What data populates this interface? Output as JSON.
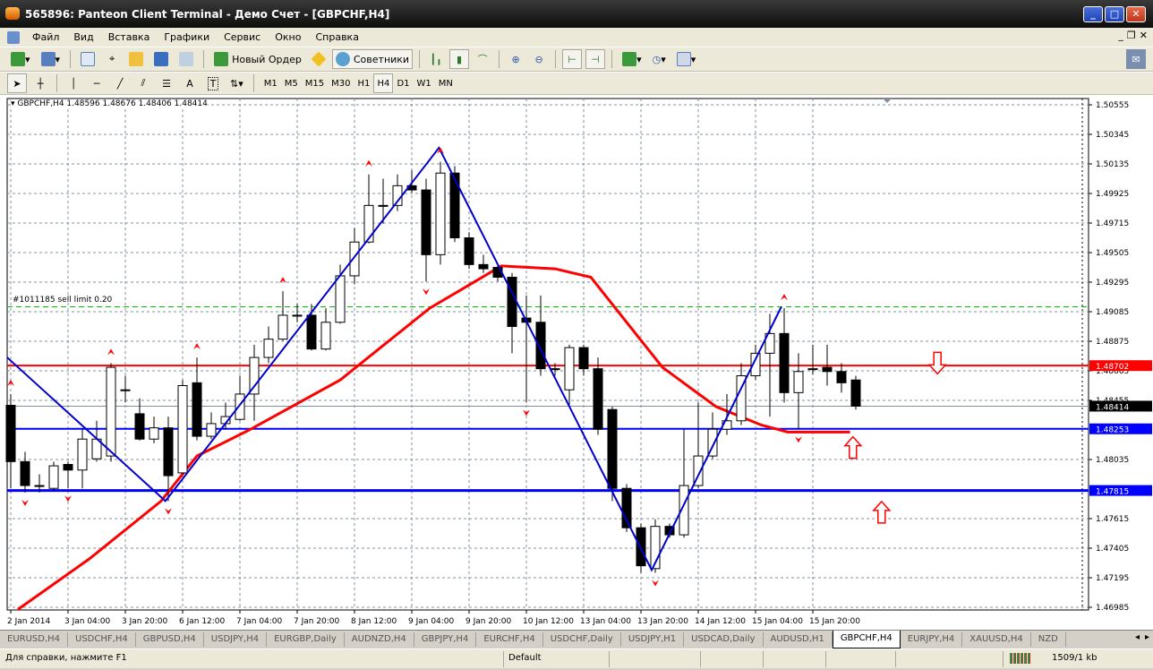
{
  "window": {
    "title": "565896: Panteon Client Terminal - Демо Счет - [GBPCHF,H4]",
    "min": "_",
    "max": "□",
    "close": "✕"
  },
  "menu": [
    "Файл",
    "Вид",
    "Вставка",
    "Графики",
    "Сервис",
    "Окно",
    "Справка"
  ],
  "mdi": {
    "min": "_",
    "restore": "❐",
    "close": "✕"
  },
  "toolbar": {
    "new_order": "Новый Ордер",
    "experts": "Советники"
  },
  "timeframes": [
    "M1",
    "M5",
    "M15",
    "M30",
    "H1",
    "H4",
    "D1",
    "W1",
    "MN"
  ],
  "active_timeframe": "H4",
  "drawing_tools": {
    "text": "A",
    "label": "T"
  },
  "chart": {
    "header": "GBPCHF,H4  1.48596 1.48676 1.48406 1.48414",
    "order_label": "#1011185 sell limit 0.20",
    "colors": {
      "bull": "#ffffff",
      "bear": "#000000",
      "ma": "#ff0000",
      "zigzag": "#0000cc",
      "grid": "#8090a0",
      "resistance": "#ff0000",
      "support": "#0000ff",
      "order": "#00c000"
    }
  },
  "chart_data": {
    "type": "candlestick",
    "symbol": "GBPCHF",
    "timeframe": "H4",
    "ylim": [
      1.46985,
      1.50555
    ],
    "y_ticks": [
      "1.50555",
      "1.50345",
      "1.50135",
      "1.49925",
      "1.49715",
      "1.49505",
      "1.49295",
      "1.49085",
      "1.48875",
      "1.48665",
      "1.48455",
      "1.48035",
      "1.47615",
      "1.47405",
      "1.47195",
      "1.46985"
    ],
    "x_ticks": [
      {
        "i": 0,
        "label": "2 Jan 2014"
      },
      {
        "i": 4,
        "label": "3 Jan 04:00"
      },
      {
        "i": 8,
        "label": "3 Jan 20:00"
      },
      {
        "i": 12,
        "label": "6 Jan 12:00"
      },
      {
        "i": 16,
        "label": "7 Jan 04:00"
      },
      {
        "i": 20,
        "label": "7 Jan 20:00"
      },
      {
        "i": 24,
        "label": "8 Jan 12:00"
      },
      {
        "i": 28,
        "label": "9 Jan 04:00"
      },
      {
        "i": 32,
        "label": "9 Jan 20:00"
      },
      {
        "i": 36,
        "label": "10 Jan 12:00"
      },
      {
        "i": 40,
        "label": "13 Jan 04:00"
      },
      {
        "i": 44,
        "label": "13 Jan 20:00"
      },
      {
        "i": 48,
        "label": "14 Jan 12:00"
      },
      {
        "i": 52,
        "label": "15 Jan 04:00"
      },
      {
        "i": 56,
        "label": "15 Jan 20:00"
      }
    ],
    "ohlc": [
      [
        1.4842,
        1.485,
        1.4783,
        1.4802
      ],
      [
        1.4802,
        1.4809,
        1.478,
        1.4785
      ],
      [
        1.4785,
        1.4793,
        1.478,
        1.4785
      ],
      [
        1.4783,
        1.4802,
        1.4781,
        1.4799
      ],
      [
        1.48,
        1.4802,
        1.4783,
        1.4796
      ],
      [
        1.4796,
        1.4825,
        1.4783,
        1.4818
      ],
      [
        1.4804,
        1.4831,
        1.4802,
        1.4818
      ],
      [
        1.4806,
        1.4872,
        1.4802,
        1.4869
      ],
      [
        1.4853,
        1.4863,
        1.4844,
        1.4853
      ],
      [
        1.4836,
        1.4847,
        1.4817,
        1.4818
      ],
      [
        1.4818,
        1.4834,
        1.4815,
        1.4826
      ],
      [
        1.4826,
        1.4834,
        1.4774,
        1.4792
      ],
      [
        1.4794,
        1.486,
        1.4793,
        1.4856
      ],
      [
        1.4858,
        1.4876,
        1.4817,
        1.482
      ],
      [
        1.482,
        1.4837,
        1.4818,
        1.4829
      ],
      [
        1.4829,
        1.4844,
        1.4825,
        1.4834
      ],
      [
        1.4832,
        1.4863,
        1.4831,
        1.485
      ],
      [
        1.485,
        1.4885,
        1.4831,
        1.4876
      ],
      [
        1.4876,
        1.4898,
        1.4872,
        1.4889
      ],
      [
        1.4889,
        1.4923,
        1.4888,
        1.4906
      ],
      [
        1.4906,
        1.4914,
        1.4901,
        1.4906
      ],
      [
        1.4906,
        1.4914,
        1.4881,
        1.4882
      ],
      [
        1.4882,
        1.4911,
        1.4881,
        1.4901
      ],
      [
        1.4901,
        1.4942,
        1.49,
        1.4934
      ],
      [
        1.4934,
        1.4968,
        1.4928,
        1.4958
      ],
      [
        1.4958,
        1.5006,
        1.4957,
        1.4984
      ],
      [
        1.4984,
        1.5003,
        1.4971,
        1.4984
      ],
      [
        1.4984,
        1.5006,
        1.498,
        1.4998
      ],
      [
        1.4998,
        1.5009,
        1.4993,
        1.4995
      ],
      [
        1.4995,
        1.5003,
        1.493,
        1.4949
      ],
      [
        1.4949,
        1.5015,
        1.4942,
        1.5007
      ],
      [
        1.5007,
        1.5012,
        1.4958,
        1.4961
      ],
      [
        1.4961,
        1.4965,
        1.4939,
        1.4942
      ],
      [
        1.4942,
        1.4949,
        1.4936,
        1.4939
      ],
      [
        1.494,
        1.4942,
        1.493,
        1.4933
      ],
      [
        1.4933,
        1.4936,
        1.4879,
        1.4898
      ],
      [
        1.4904,
        1.492,
        1.4844,
        1.4901
      ],
      [
        1.4901,
        1.492,
        1.4863,
        1.4868
      ],
      [
        1.4868,
        1.4872,
        1.4863,
        1.4868
      ],
      [
        1.4853,
        1.4885,
        1.4841,
        1.4883
      ],
      [
        1.4883,
        1.4885,
        1.4863,
        1.4868
      ],
      [
        1.4868,
        1.4876,
        1.4821,
        1.4825
      ],
      [
        1.4839,
        1.4841,
        1.4774,
        1.4783
      ],
      [
        1.4783,
        1.4786,
        1.4752,
        1.4755
      ],
      [
        1.4755,
        1.4758,
        1.4723,
        1.4728
      ],
      [
        1.4726,
        1.4761,
        1.4723,
        1.4756
      ],
      [
        1.4756,
        1.4758,
        1.4748,
        1.475
      ],
      [
        1.475,
        1.4825,
        1.4748,
        1.4785
      ],
      [
        1.4785,
        1.4844,
        1.4783,
        1.4806
      ],
      [
        1.4806,
        1.4837,
        1.4804,
        1.4825
      ],
      [
        1.4825,
        1.485,
        1.4821,
        1.4831
      ],
      [
        1.4831,
        1.4872,
        1.4828,
        1.4863
      ],
      [
        1.4863,
        1.4885,
        1.486,
        1.4879
      ],
      [
        1.4879,
        1.4907,
        1.4834,
        1.4893
      ],
      [
        1.4893,
        1.4911,
        1.4844,
        1.4851
      ],
      [
        1.4851,
        1.4879,
        1.4825,
        1.4866
      ],
      [
        1.4868,
        1.4885,
        1.4864,
        1.4868
      ],
      [
        1.4869,
        1.4885,
        1.4856,
        1.4866
      ],
      [
        1.4866,
        1.4872,
        1.4851,
        1.4858
      ],
      [
        1.486,
        1.4863,
        1.4839,
        1.48414
      ]
    ],
    "moving_average": [
      [
        0.5,
        1.4697
      ],
      [
        5.5,
        1.4733
      ],
      [
        10.5,
        1.4774
      ],
      [
        13,
        1.4806
      ],
      [
        16.75,
        1.4825
      ],
      [
        23,
        1.486
      ],
      [
        29.25,
        1.4911
      ],
      [
        34.25,
        1.4941
      ],
      [
        38,
        1.4939
      ],
      [
        40.5,
        1.4933
      ],
      [
        43,
        1.4901
      ],
      [
        45.5,
        1.4869
      ],
      [
        49.25,
        1.4841
      ],
      [
        52.4,
        1.4828
      ],
      [
        54.25,
        1.4823
      ],
      [
        58.6,
        1.4823
      ]
    ],
    "zigzag": [
      [
        -0.25,
        1.4876
      ],
      [
        10.8,
        1.4774
      ],
      [
        29.9,
        1.5025
      ],
      [
        44.75,
        1.4725
      ],
      [
        53.8,
        1.4912
      ]
    ],
    "fractals_up": [
      0,
      7,
      13,
      19,
      25,
      30,
      54
    ],
    "fractals_down": [
      1,
      4,
      11,
      29,
      36,
      45,
      55
    ],
    "signal_arrows": [
      {
        "dir": "down",
        "i": 64.7,
        "price": 1.4872
      },
      {
        "dir": "up",
        "i": 58.8,
        "price": 1.4812
      },
      {
        "dir": "up",
        "i": 60.8,
        "price": 1.4766
      }
    ],
    "hlines": [
      {
        "price": 1.4912,
        "label": "",
        "style": "order"
      },
      {
        "price": 1.48702,
        "label": "1.48702",
        "style": "resistance"
      },
      {
        "price": 1.48414,
        "label": "1.48414",
        "style": "bid"
      },
      {
        "price": 1.48253,
        "label": "1.48253",
        "style": "support"
      },
      {
        "price": 1.47815,
        "label": "1.47815",
        "style": "support-thick"
      }
    ]
  },
  "tabs": [
    "EURUSD,H4",
    "USDCHF,H4",
    "GBPUSD,H4",
    "USDJPY,H4",
    "EURGBP,Daily",
    "AUDNZD,H4",
    "GBPJPY,H4",
    "EURCHF,H4",
    "USDCHF,Daily",
    "USDJPY,H1",
    "USDCAD,Daily",
    "AUDUSD,H1",
    "GBPCHF,H4",
    "EURJPY,H4",
    "XAUUSD,H4",
    "NZD"
  ],
  "active_tab": "GBPCHF,H4",
  "status": {
    "help": "Для справки, нажмите F1",
    "profile": "Default",
    "traffic": "1509/1 kb"
  }
}
